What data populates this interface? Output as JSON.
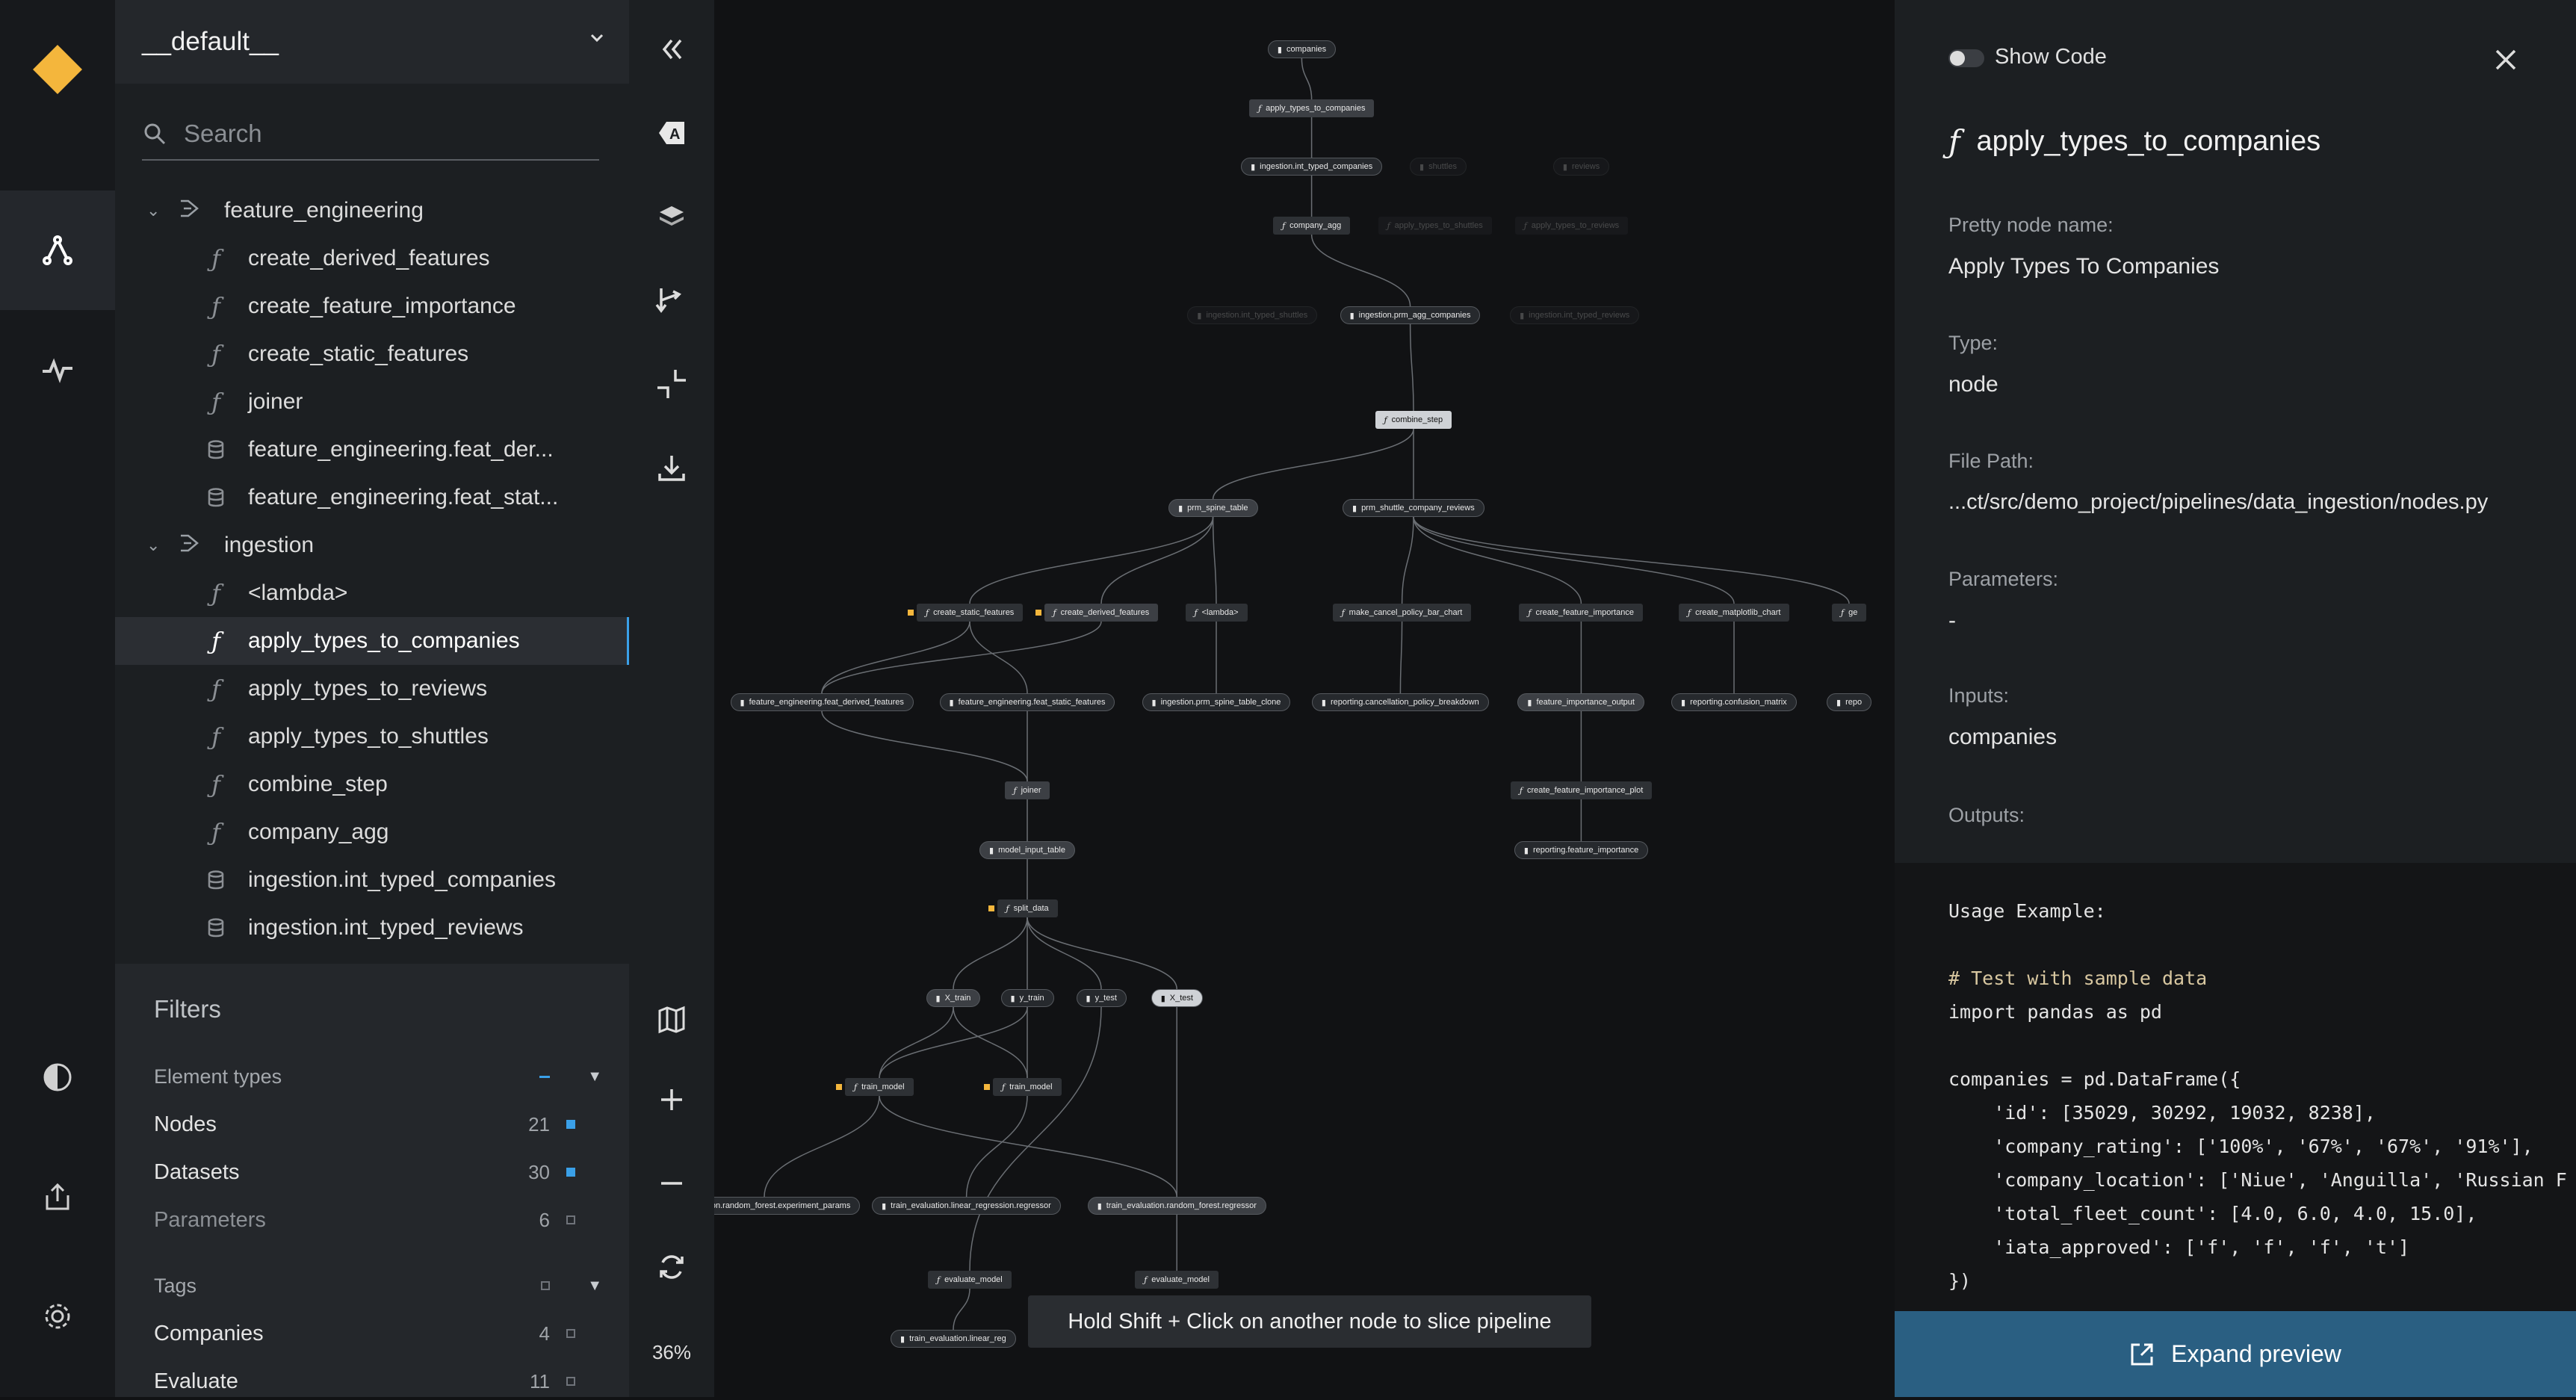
{
  "app": {
    "logo_color": "#f4b63c"
  },
  "sidebar": {
    "pipeline": "__default__",
    "search_placeholder": "Search",
    "tree": [
      {
        "kind": "group",
        "label": "feature_engineering"
      },
      {
        "kind": "node",
        "label": "create_derived_features"
      },
      {
        "kind": "node",
        "label": "create_feature_importance"
      },
      {
        "kind": "node",
        "label": "create_static_features"
      },
      {
        "kind": "node",
        "label": "joiner"
      },
      {
        "kind": "dataset",
        "label": "feature_engineering.feat_der..."
      },
      {
        "kind": "dataset",
        "label": "feature_engineering.feat_stat..."
      },
      {
        "kind": "group",
        "label": "ingestion"
      },
      {
        "kind": "node",
        "label": "<lambda>"
      },
      {
        "kind": "node",
        "label": "apply_types_to_companies",
        "selected": true
      },
      {
        "kind": "node",
        "label": "apply_types_to_reviews"
      },
      {
        "kind": "node",
        "label": "apply_types_to_shuttles"
      },
      {
        "kind": "node",
        "label": "combine_step"
      },
      {
        "kind": "node",
        "label": "company_agg"
      },
      {
        "kind": "dataset",
        "label": "ingestion.int_typed_companies"
      },
      {
        "kind": "dataset",
        "label": "ingestion.int_typed_reviews"
      }
    ]
  },
  "filters": {
    "title": "Filters",
    "element_types_label": "Element types",
    "nodes": {
      "label": "Nodes",
      "count": "21"
    },
    "datasets": {
      "label": "Datasets",
      "count": "30"
    },
    "parameters": {
      "label": "Parameters",
      "count": "6"
    },
    "tags_label": "Tags",
    "companies": {
      "label": "Companies",
      "count": "4"
    },
    "evaluate": {
      "label": "Evaluate",
      "count": "11"
    }
  },
  "toolbar": {
    "zoom": "36%"
  },
  "graph": {
    "hint": "Hold Shift + Click on another node to slice pipeline",
    "nodes": [
      {
        "t": "companies",
        "k": "ds"
      },
      {
        "t": "apply_types_to_companies",
        "k": "fn",
        "hl": true
      },
      {
        "t": "ingestion.int_typed_companies",
        "k": "ds"
      },
      {
        "t": "shuttles",
        "k": "ds",
        "dim": true
      },
      {
        "t": "reviews",
        "k": "ds",
        "dim": true
      },
      {
        "t": "company_agg",
        "k": "fn"
      },
      {
        "t": "apply_types_to_shuttles",
        "k": "fn",
        "dim": true
      },
      {
        "t": "apply_types_to_reviews",
        "k": "fn",
        "dim": true
      },
      {
        "t": "ingestion.int_typed_shuttles",
        "k": "ds",
        "dim": true
      },
      {
        "t": "ingestion.prm_agg_companies",
        "k": "ds"
      },
      {
        "t": "ingestion.int_typed_reviews",
        "k": "ds",
        "dim": true
      },
      {
        "t": "combine_step",
        "k": "fn",
        "light": true
      },
      {
        "t": "prm_spine_table",
        "k": "ds",
        "hl": true
      },
      {
        "t": "prm_shuttle_company_reviews",
        "k": "ds"
      },
      {
        "t": "create_static_features",
        "k": "fn",
        "sq": true
      },
      {
        "t": "create_derived_features",
        "k": "fn",
        "sq": true,
        "hl": true
      },
      {
        "t": "<lambda>",
        "k": "fn"
      },
      {
        "t": "make_cancel_policy_bar_chart",
        "k": "fn"
      },
      {
        "t": "create_feature_importance",
        "k": "fn"
      },
      {
        "t": "create_matplotlib_chart",
        "k": "fn"
      },
      {
        "t": "ge",
        "k": "fn"
      },
      {
        "t": "feature_engineering.feat_derived_features",
        "k": "ds"
      },
      {
        "t": "feature_engineering.feat_static_features",
        "k": "ds"
      },
      {
        "t": "ingestion.prm_spine_table_clone",
        "k": "ds"
      },
      {
        "t": "reporting.cancellation_policy_breakdown",
        "k": "ds"
      },
      {
        "t": "feature_importance_output",
        "k": "ds",
        "hl": true
      },
      {
        "t": "reporting.confusion_matrix",
        "k": "ds"
      },
      {
        "t": "repo",
        "k": "ds"
      },
      {
        "t": "joiner",
        "k": "fn",
        "hl": true
      },
      {
        "t": "create_feature_importance_plot",
        "k": "fn"
      },
      {
        "t": "model_input_table",
        "k": "ds",
        "hl": true
      },
      {
        "t": "reporting.feature_importance",
        "k": "ds"
      },
      {
        "t": "split_data",
        "k": "fn",
        "sq": true
      },
      {
        "t": "X_train",
        "k": "ds",
        "hl": true
      },
      {
        "t": "y_train",
        "k": "ds"
      },
      {
        "t": "y_test",
        "k": "ds"
      },
      {
        "t": "X_test",
        "k": "ds",
        "light": true
      },
      {
        "t": "train_model",
        "k": "fn",
        "sq": true
      },
      {
        "t": "train_model",
        "k": "fn",
        "sq": true
      },
      {
        "t": "valuation.random_forest.experiment_params",
        "k": "ds"
      },
      {
        "t": "train_evaluation.linear_regression.regressor",
        "k": "ds"
      },
      {
        "t": "train_evaluation.random_forest.regressor",
        "k": "ds",
        "hl": true
      },
      {
        "t": "evaluate_model",
        "k": "fn"
      },
      {
        "t": "evaluate_model",
        "k": "fn"
      },
      {
        "t": "train_evaluation.linear_reg",
        "k": "ds"
      }
    ]
  },
  "meta": {
    "show_code_label": "Show Code",
    "title": "apply_types_to_companies",
    "pretty_name_label": "Pretty node name:",
    "pretty_name": "Apply Types To Companies",
    "type_label": "Type:",
    "type": "node",
    "file_path_label": "File Path:",
    "file_path": "...ct/src/demo_project/pipelines/data_ingestion/nodes.py",
    "parameters_label": "Parameters:",
    "parameters": "-",
    "inputs_label": "Inputs:",
    "inputs": "companies",
    "outputs_label": "Outputs:",
    "code_lines": [
      "Usage Example:",
      "",
      "# Test with sample data",
      "import pandas as pd",
      "",
      "companies = pd.DataFrame({",
      "    'id': [35029, 30292, 19032, 8238],",
      "    'company_rating': ['100%', '67%', '67%', '91%'],",
      "    'company_location': ['Niue', 'Anguilla', 'Russian F",
      "    'total_fleet_count': [4.0, 6.0, 4.0, 15.0],",
      "    'iata_approved': ['f', 'f', 'f', 't']",
      "})"
    ],
    "expand_label": "Expand preview"
  }
}
